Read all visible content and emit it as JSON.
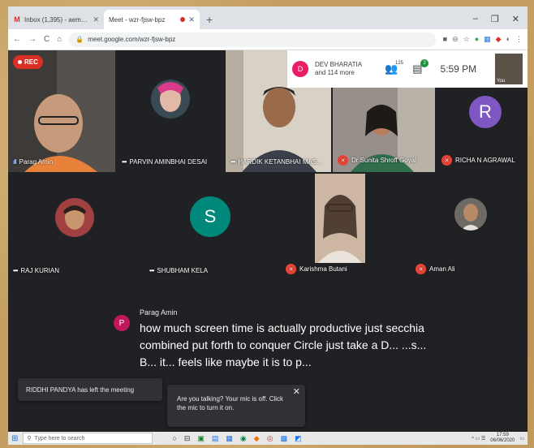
{
  "browser": {
    "tabs": [
      {
        "title": "Inbox (1,395) - aem@...",
        "type": "gmail"
      },
      {
        "title": "Meet - wzr-fjsw-bpz",
        "type": "meet",
        "recording": true
      }
    ],
    "url": "meet.google.com/wzr-fjsw-bpz"
  },
  "meeting": {
    "rec_label": "REC",
    "presenter_initial": "D",
    "presenter_text": "DEV BHARATIA and 114 more",
    "participant_count": "125",
    "chat_badge": "2",
    "time": "5:59 PM",
    "self_label": "You",
    "tiles": [
      {
        "name": "Parag Amin",
        "status": "speaking"
      },
      {
        "name": "PARVIN AMINBHAI DESAI",
        "status": "menu"
      },
      {
        "name": "HARDIK KETANBHAI MAS...",
        "status": "menu"
      },
      {
        "name": "Dr Sunita Shroff Goyal",
        "status": "muted"
      },
      {
        "name": "RICHA N AGRAWAL",
        "status": "muted",
        "initial": "R",
        "color": "#7e57c2"
      },
      {
        "name": "RAJ KURIAN",
        "status": "menu"
      },
      {
        "name": "SHUBHAM KELA",
        "status": "menu",
        "initial": "S",
        "color": "#00897b"
      },
      {
        "name": "Karishma Butani",
        "status": "muted"
      },
      {
        "name": "Aman Ali",
        "status": "muted"
      }
    ],
    "caption": {
      "initial": "P",
      "speaker": "Parag Amin",
      "text": "how much screen time is actually productive just secchia combined put forth to conquer Circle just take a D... ...s... B... it... feels like maybe it is to p..."
    },
    "toast": "RIDDHI PANDYA has left the meeting",
    "mic_popup": "Are you talking? Your mic is off. Click the mic to turn it on."
  },
  "taskbar": {
    "search_placeholder": "Type here to search",
    "time": "17:59",
    "date": "06/06/2020"
  }
}
